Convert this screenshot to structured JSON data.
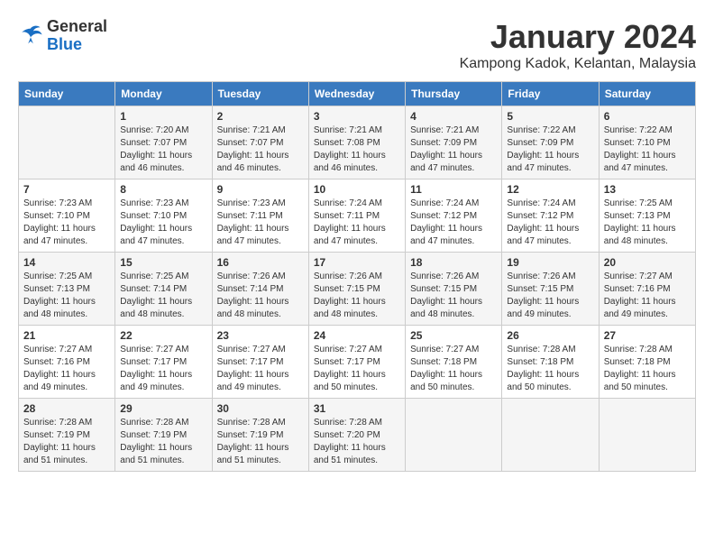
{
  "header": {
    "logo": {
      "general": "General",
      "blue": "Blue"
    },
    "title": "January 2024",
    "location": "Kampong Kadok, Kelantan, Malaysia"
  },
  "calendar": {
    "weekdays": [
      "Sunday",
      "Monday",
      "Tuesday",
      "Wednesday",
      "Thursday",
      "Friday",
      "Saturday"
    ],
    "weeks": [
      [
        {
          "day": "",
          "sunrise": "",
          "sunset": "",
          "daylight": ""
        },
        {
          "day": "1",
          "sunrise": "Sunrise: 7:20 AM",
          "sunset": "Sunset: 7:07 PM",
          "daylight": "Daylight: 11 hours and 46 minutes."
        },
        {
          "day": "2",
          "sunrise": "Sunrise: 7:21 AM",
          "sunset": "Sunset: 7:07 PM",
          "daylight": "Daylight: 11 hours and 46 minutes."
        },
        {
          "day": "3",
          "sunrise": "Sunrise: 7:21 AM",
          "sunset": "Sunset: 7:08 PM",
          "daylight": "Daylight: 11 hours and 46 minutes."
        },
        {
          "day": "4",
          "sunrise": "Sunrise: 7:21 AM",
          "sunset": "Sunset: 7:09 PM",
          "daylight": "Daylight: 11 hours and 47 minutes."
        },
        {
          "day": "5",
          "sunrise": "Sunrise: 7:22 AM",
          "sunset": "Sunset: 7:09 PM",
          "daylight": "Daylight: 11 hours and 47 minutes."
        },
        {
          "day": "6",
          "sunrise": "Sunrise: 7:22 AM",
          "sunset": "Sunset: 7:10 PM",
          "daylight": "Daylight: 11 hours and 47 minutes."
        }
      ],
      [
        {
          "day": "7",
          "sunrise": "Sunrise: 7:23 AM",
          "sunset": "Sunset: 7:10 PM",
          "daylight": "Daylight: 11 hours and 47 minutes."
        },
        {
          "day": "8",
          "sunrise": "Sunrise: 7:23 AM",
          "sunset": "Sunset: 7:10 PM",
          "daylight": "Daylight: 11 hours and 47 minutes."
        },
        {
          "day": "9",
          "sunrise": "Sunrise: 7:23 AM",
          "sunset": "Sunset: 7:11 PM",
          "daylight": "Daylight: 11 hours and 47 minutes."
        },
        {
          "day": "10",
          "sunrise": "Sunrise: 7:24 AM",
          "sunset": "Sunset: 7:11 PM",
          "daylight": "Daylight: 11 hours and 47 minutes."
        },
        {
          "day": "11",
          "sunrise": "Sunrise: 7:24 AM",
          "sunset": "Sunset: 7:12 PM",
          "daylight": "Daylight: 11 hours and 47 minutes."
        },
        {
          "day": "12",
          "sunrise": "Sunrise: 7:24 AM",
          "sunset": "Sunset: 7:12 PM",
          "daylight": "Daylight: 11 hours and 47 minutes."
        },
        {
          "day": "13",
          "sunrise": "Sunrise: 7:25 AM",
          "sunset": "Sunset: 7:13 PM",
          "daylight": "Daylight: 11 hours and 48 minutes."
        }
      ],
      [
        {
          "day": "14",
          "sunrise": "Sunrise: 7:25 AM",
          "sunset": "Sunset: 7:13 PM",
          "daylight": "Daylight: 11 hours and 48 minutes."
        },
        {
          "day": "15",
          "sunrise": "Sunrise: 7:25 AM",
          "sunset": "Sunset: 7:14 PM",
          "daylight": "Daylight: 11 hours and 48 minutes."
        },
        {
          "day": "16",
          "sunrise": "Sunrise: 7:26 AM",
          "sunset": "Sunset: 7:14 PM",
          "daylight": "Daylight: 11 hours and 48 minutes."
        },
        {
          "day": "17",
          "sunrise": "Sunrise: 7:26 AM",
          "sunset": "Sunset: 7:15 PM",
          "daylight": "Daylight: 11 hours and 48 minutes."
        },
        {
          "day": "18",
          "sunrise": "Sunrise: 7:26 AM",
          "sunset": "Sunset: 7:15 PM",
          "daylight": "Daylight: 11 hours and 48 minutes."
        },
        {
          "day": "19",
          "sunrise": "Sunrise: 7:26 AM",
          "sunset": "Sunset: 7:15 PM",
          "daylight": "Daylight: 11 hours and 49 minutes."
        },
        {
          "day": "20",
          "sunrise": "Sunrise: 7:27 AM",
          "sunset": "Sunset: 7:16 PM",
          "daylight": "Daylight: 11 hours and 49 minutes."
        }
      ],
      [
        {
          "day": "21",
          "sunrise": "Sunrise: 7:27 AM",
          "sunset": "Sunset: 7:16 PM",
          "daylight": "Daylight: 11 hours and 49 minutes."
        },
        {
          "day": "22",
          "sunrise": "Sunrise: 7:27 AM",
          "sunset": "Sunset: 7:17 PM",
          "daylight": "Daylight: 11 hours and 49 minutes."
        },
        {
          "day": "23",
          "sunrise": "Sunrise: 7:27 AM",
          "sunset": "Sunset: 7:17 PM",
          "daylight": "Daylight: 11 hours and 49 minutes."
        },
        {
          "day": "24",
          "sunrise": "Sunrise: 7:27 AM",
          "sunset": "Sunset: 7:17 PM",
          "daylight": "Daylight: 11 hours and 50 minutes."
        },
        {
          "day": "25",
          "sunrise": "Sunrise: 7:27 AM",
          "sunset": "Sunset: 7:18 PM",
          "daylight": "Daylight: 11 hours and 50 minutes."
        },
        {
          "day": "26",
          "sunrise": "Sunrise: 7:28 AM",
          "sunset": "Sunset: 7:18 PM",
          "daylight": "Daylight: 11 hours and 50 minutes."
        },
        {
          "day": "27",
          "sunrise": "Sunrise: 7:28 AM",
          "sunset": "Sunset: 7:18 PM",
          "daylight": "Daylight: 11 hours and 50 minutes."
        }
      ],
      [
        {
          "day": "28",
          "sunrise": "Sunrise: 7:28 AM",
          "sunset": "Sunset: 7:19 PM",
          "daylight": "Daylight: 11 hours and 51 minutes."
        },
        {
          "day": "29",
          "sunrise": "Sunrise: 7:28 AM",
          "sunset": "Sunset: 7:19 PM",
          "daylight": "Daylight: 11 hours and 51 minutes."
        },
        {
          "day": "30",
          "sunrise": "Sunrise: 7:28 AM",
          "sunset": "Sunset: 7:19 PM",
          "daylight": "Daylight: 11 hours and 51 minutes."
        },
        {
          "day": "31",
          "sunrise": "Sunrise: 7:28 AM",
          "sunset": "Sunset: 7:20 PM",
          "daylight": "Daylight: 11 hours and 51 minutes."
        },
        {
          "day": "",
          "sunrise": "",
          "sunset": "",
          "daylight": ""
        },
        {
          "day": "",
          "sunrise": "",
          "sunset": "",
          "daylight": ""
        },
        {
          "day": "",
          "sunrise": "",
          "sunset": "",
          "daylight": ""
        }
      ]
    ]
  }
}
